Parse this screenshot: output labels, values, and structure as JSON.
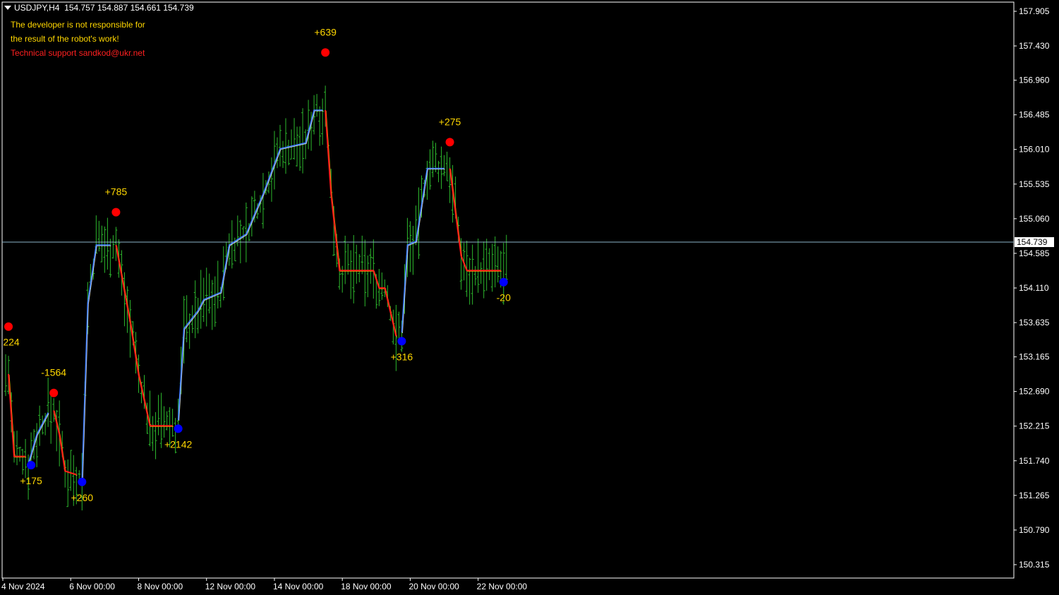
{
  "header": {
    "symbol_timeframe": "USDJPY,H4",
    "quote": "154.757 154.887 154.661 154.739"
  },
  "notice": {
    "line1": "The developer is not responsible for",
    "line2": "the result of the robot's work!",
    "line3": "Technical support sandkod@ukr.net"
  },
  "colors": {
    "background": "#000000",
    "bars": "#2db82d",
    "uptrend": "#3f7fff",
    "downtrend": "#ff1a1a",
    "buy_marker": "#0000ff",
    "sell_marker": "#ff0000",
    "annotation": "#ffd700",
    "notice_text": "#ffd700",
    "notice_support": "#ff2020",
    "price_line": "#8cb4c8",
    "axis": "#ffffff"
  },
  "chart_data": {
    "type": "line",
    "symbol": "USDJPY",
    "timeframe": "H4",
    "current_price": 154.739,
    "y_ticks": [
      157.905,
      157.43,
      156.96,
      156.485,
      156.01,
      155.535,
      155.06,
      154.585,
      154.11,
      153.635,
      153.165,
      152.69,
      152.215,
      151.74,
      151.265,
      150.79,
      150.315
    ],
    "x_ticks": [
      {
        "label": "4 Nov 2024",
        "bar": 0
      },
      {
        "label": "6 Nov 00:00",
        "bar": 24
      },
      {
        "label": "8 Nov 00:00",
        "bar": 48
      },
      {
        "label": "12 Nov 00:00",
        "bar": 72
      },
      {
        "label": "14 Nov 00:00",
        "bar": 96
      },
      {
        "label": "18 Nov 00:00",
        "bar": 120
      },
      {
        "label": "20 Nov 00:00",
        "bar": 144
      },
      {
        "label": "22 Nov 00:00",
        "bar": 168
      }
    ],
    "bars_range": [
      1,
      178
    ],
    "trend_segments": [
      {
        "trend": "down",
        "points": [
          [
            2,
            152.93
          ],
          [
            4,
            151.8
          ],
          [
            8,
            151.8
          ]
        ]
      },
      {
        "trend": "up",
        "points": [
          [
            9,
            151.7
          ],
          [
            12,
            152.1
          ],
          [
            16,
            152.4
          ]
        ]
      },
      {
        "trend": "down",
        "points": [
          [
            18,
            152.43
          ],
          [
            20,
            152.1
          ],
          [
            22,
            151.6
          ],
          [
            26,
            151.55
          ]
        ]
      },
      {
        "trend": "up",
        "points": [
          [
            28,
            151.5
          ],
          [
            30,
            153.9
          ],
          [
            33,
            154.7
          ],
          [
            38,
            154.7
          ]
        ]
      },
      {
        "trend": "down",
        "points": [
          [
            40,
            154.7
          ],
          [
            45,
            153.65
          ],
          [
            48,
            152.92
          ],
          [
            52,
            152.22
          ],
          [
            60,
            152.22
          ]
        ]
      },
      {
        "trend": "up",
        "points": [
          [
            62,
            152.3
          ],
          [
            64,
            153.55
          ],
          [
            69,
            153.8
          ],
          [
            71,
            153.95
          ],
          [
            77,
            154.05
          ],
          [
            80,
            154.7
          ],
          [
            86,
            154.85
          ],
          [
            92,
            155.4
          ],
          [
            98,
            156.02
          ],
          [
            107,
            156.1
          ],
          [
            110,
            156.55
          ],
          [
            113,
            156.55
          ]
        ]
      },
      {
        "trend": "down",
        "points": [
          [
            114,
            156.55
          ],
          [
            116,
            155.4
          ],
          [
            119,
            154.35
          ],
          [
            131,
            154.35
          ],
          [
            133,
            154.11
          ],
          [
            135,
            154.11
          ],
          [
            139,
            153.45
          ]
        ]
      },
      {
        "trend": "up",
        "points": [
          [
            141,
            153.5
          ],
          [
            143,
            154.7
          ],
          [
            146,
            154.75
          ],
          [
            150,
            155.75
          ],
          [
            156,
            155.75
          ]
        ]
      },
      {
        "trend": "down",
        "points": [
          [
            158,
            155.75
          ],
          [
            162,
            154.55
          ],
          [
            164,
            154.35
          ],
          [
            176,
            154.35
          ]
        ]
      }
    ],
    "markers": [
      {
        "type": "sell",
        "bar": 2,
        "price": 153.58,
        "label": "224"
      },
      {
        "type": "buy",
        "bar": 10,
        "price": 151.68,
        "label": "+175"
      },
      {
        "type": "sell",
        "bar": 18,
        "price": 152.67,
        "label": "-1564"
      },
      {
        "type": "buy",
        "bar": 28,
        "price": 151.45,
        "label": "+260"
      },
      {
        "type": "sell",
        "bar": 40,
        "price": 155.15,
        "label": "+785"
      },
      {
        "type": "buy",
        "bar": 62,
        "price": 152.18,
        "label": "+2142"
      },
      {
        "type": "sell",
        "bar": 114,
        "price": 157.34,
        "label": "+639"
      },
      {
        "type": "buy",
        "bar": 141,
        "price": 153.38,
        "label": "+316"
      },
      {
        "type": "sell",
        "bar": 158,
        "price": 156.11,
        "label": "+275"
      },
      {
        "type": "buy",
        "bar": 177,
        "price": 154.19,
        "label": "-20"
      }
    ],
    "annotation_placement": "sell labels above marker, buy labels below marker"
  }
}
